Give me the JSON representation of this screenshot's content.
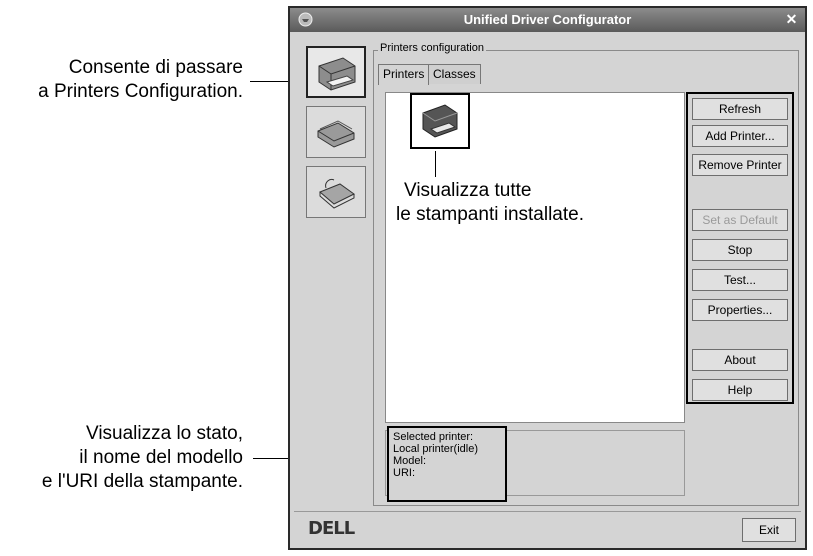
{
  "window": {
    "title": "Unified Driver Configurator"
  },
  "group_label": "Printers configuration",
  "tabs": [
    {
      "label": "Printers",
      "active": true
    },
    {
      "label": "Classes",
      "active": false
    }
  ],
  "buttons": [
    {
      "label": "Refresh",
      "enabled": true
    },
    {
      "label": "Add Printer...",
      "enabled": true
    },
    {
      "label": "Remove Printer",
      "enabled": true
    },
    {
      "label": "Set as Default",
      "enabled": false
    },
    {
      "label": "Stop",
      "enabled": true
    },
    {
      "label": "Test...",
      "enabled": true
    },
    {
      "label": "Properties...",
      "enabled": true
    },
    {
      "label": "About",
      "enabled": true
    },
    {
      "label": "Help",
      "enabled": true
    }
  ],
  "status": {
    "selected_label": "Selected printer:",
    "printer_state": "Local printer(idle)",
    "model_label": "Model:",
    "uri_label": "URI:"
  },
  "footer": {
    "logo": "DELL",
    "exit_label": "Exit"
  },
  "callouts": {
    "top_line1": "Consente di passare",
    "top_line2": "a Printers Configuration.",
    "middle_line1": "Visualizza tutte",
    "middle_line2": "le stampanti installate.",
    "bottom_line1": "Visualizza lo stato,",
    "bottom_line2": "il nome del modello",
    "bottom_line3": "e l'URI della stampante."
  },
  "icons": {
    "sidebar": [
      "printer-icon",
      "scanner-icon",
      "port-icon"
    ],
    "list": [
      "printer-icon"
    ]
  }
}
